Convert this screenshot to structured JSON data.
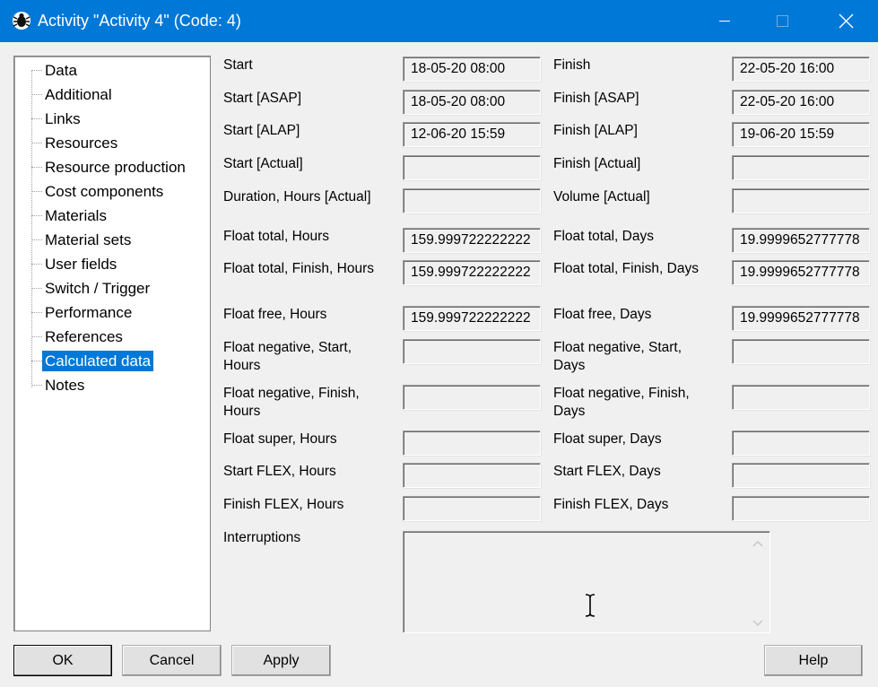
{
  "window": {
    "title": "Activity \"Activity 4\" (Code: 4)",
    "icon": "bug-app-icon",
    "controls": [
      "minimize-icon",
      "maximize-icon",
      "close-icon"
    ]
  },
  "tree": {
    "items": [
      {
        "label": "Data",
        "selected": false
      },
      {
        "label": "Additional",
        "selected": false
      },
      {
        "label": "Links",
        "selected": false
      },
      {
        "label": "Resources",
        "selected": false
      },
      {
        "label": "Resource production",
        "selected": false
      },
      {
        "label": "Cost components",
        "selected": false
      },
      {
        "label": "Materials",
        "selected": false
      },
      {
        "label": "Material sets",
        "selected": false
      },
      {
        "label": "User fields",
        "selected": false
      },
      {
        "label": "Switch / Trigger",
        "selected": false
      },
      {
        "label": "Performance",
        "selected": false
      },
      {
        "label": "References",
        "selected": false
      },
      {
        "label": "Calculated data",
        "selected": true
      },
      {
        "label": "Notes",
        "selected": false
      }
    ]
  },
  "fields": {
    "start": {
      "label": "Start",
      "value": "18-05-20  08:00"
    },
    "finish": {
      "label": "Finish",
      "value": "22-05-20  16:00"
    },
    "start_asap": {
      "label": "Start [ASAP]",
      "value": "18-05-20  08:00"
    },
    "finish_asap": {
      "label": "Finish [ASAP]",
      "value": "22-05-20  16:00"
    },
    "start_alap": {
      "label": "Start [ALAP]",
      "value": "12-06-20  15:59"
    },
    "finish_alap": {
      "label": "Finish [ALAP]",
      "value": "19-06-20  15:59"
    },
    "start_actual": {
      "label": "Start [Actual]",
      "value": ""
    },
    "finish_actual": {
      "label": "Finish [Actual]",
      "value": ""
    },
    "duration_actual": {
      "label": "Duration, Hours [Actual]",
      "value": ""
    },
    "volume_actual": {
      "label": "Volume [Actual]",
      "value": ""
    },
    "float_total_hours": {
      "label": "Float total, Hours",
      "value": "159.999722222222"
    },
    "float_total_days": {
      "label": "Float total, Days",
      "value": "19.9999652777778"
    },
    "float_total_finish_hours": {
      "label": "Float total, Finish, Hours",
      "value": "159.999722222222"
    },
    "float_total_finish_days": {
      "label": "Float total, Finish, Days",
      "value": "19.9999652777778"
    },
    "float_free_hours": {
      "label": "Float free, Hours",
      "value": "159.999722222222"
    },
    "float_free_days": {
      "label": "Float free, Days",
      "value": "19.9999652777778"
    },
    "float_neg_start_hours": {
      "label1": "Float negative, Start,",
      "label2": "Hours",
      "value": ""
    },
    "float_neg_start_days": {
      "label1": "Float negative, Start,",
      "label2": "Days",
      "value": ""
    },
    "float_neg_finish_hours": {
      "label1": "Float negative, Finish,",
      "label2": "Hours",
      "value": ""
    },
    "float_neg_finish_days": {
      "label1": "Float negative, Finish,",
      "label2": "Days",
      "value": ""
    },
    "float_super_hours": {
      "label": "Float super, Hours",
      "value": ""
    },
    "float_super_days": {
      "label": "Float super, Days",
      "value": ""
    },
    "start_flex_hours": {
      "label": "Start FLEX, Hours",
      "value": ""
    },
    "start_flex_days": {
      "label": "Start FLEX, Days",
      "value": ""
    },
    "finish_flex_hours": {
      "label": "Finish FLEX, Hours",
      "value": ""
    },
    "finish_flex_days": {
      "label": "Finish FLEX, Days",
      "value": ""
    },
    "interruptions": {
      "label": "Interruptions",
      "value": ""
    }
  },
  "buttons": {
    "ok": "OK",
    "cancel": "Cancel",
    "apply": "Apply",
    "help": "Help"
  },
  "colors": {
    "titlebar": "#0078d7",
    "selection": "#0078d7",
    "background": "#f0f0f0"
  }
}
